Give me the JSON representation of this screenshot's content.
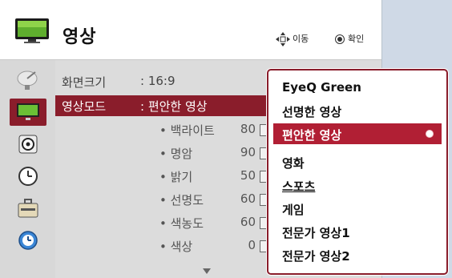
{
  "header": {
    "title": "영상",
    "hint_move": "이동",
    "hint_ok": "확인"
  },
  "sidebar": {
    "items": [
      {
        "icon": "satellite-dish-icon"
      },
      {
        "icon": "tv-picture-icon",
        "active": true
      },
      {
        "icon": "speaker-audio-icon"
      },
      {
        "icon": "clock-time-icon"
      },
      {
        "icon": "toolbox-option-icon"
      },
      {
        "icon": "globe-network-icon"
      }
    ]
  },
  "settings": {
    "aspect": {
      "label": "화면크기",
      "value": ": 16:9"
    },
    "mode": {
      "label": "영상모드",
      "value": ": 편안한 영상"
    },
    "adjust": [
      {
        "label": "• 백라이트",
        "value": "80"
      },
      {
        "label": "• 명암",
        "value": "90"
      },
      {
        "label": "• 밝기",
        "value": "50"
      },
      {
        "label": "• 선명도",
        "value": "60"
      },
      {
        "label": "• 색농도",
        "value": "60"
      },
      {
        "label": "• 색상",
        "value": "0"
      }
    ]
  },
  "mode_popup": {
    "options": [
      "EyeQ Green",
      "선명한 영상",
      "편안한 영상",
      "영화",
      "스포츠",
      "게임",
      "전문가 영상1",
      "전문가 영상2"
    ],
    "selected": "편안한 영상"
  },
  "colors": {
    "accent": "#8a1d2b",
    "highlight": "#b11f34"
  }
}
